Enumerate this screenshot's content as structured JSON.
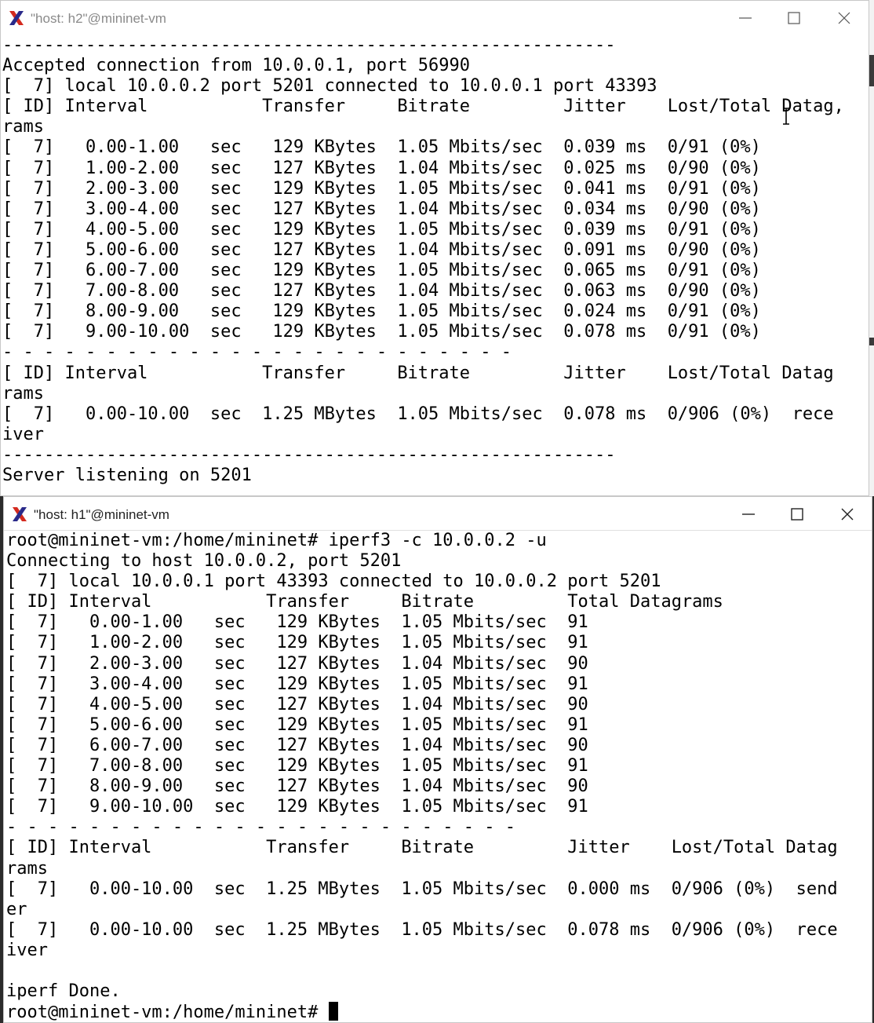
{
  "windows": [
    {
      "id": "h2",
      "title": "\"host: h2\"@mininet-vm",
      "lines": [
        "-----------------------------------------------------------",
        "Accepted connection from 10.0.0.1, port 56990",
        "[  7] local 10.0.0.2 port 5201 connected to 10.0.0.1 port 43393",
        "[ ID] Interval           Transfer     Bitrate         Jitter    Lost/Total Datag,",
        "rams",
        "[  7]   0.00-1.00   sec   129 KBytes  1.05 Mbits/sec  0.039 ms  0/91 (0%)",
        "[  7]   1.00-2.00   sec   127 KBytes  1.04 Mbits/sec  0.025 ms  0/90 (0%)",
        "[  7]   2.00-3.00   sec   129 KBytes  1.05 Mbits/sec  0.041 ms  0/91 (0%)",
        "[  7]   3.00-4.00   sec   127 KBytes  1.04 Mbits/sec  0.034 ms  0/90 (0%)",
        "[  7]   4.00-5.00   sec   129 KBytes  1.05 Mbits/sec  0.039 ms  0/91 (0%)",
        "[  7]   5.00-6.00   sec   127 KBytes  1.04 Mbits/sec  0.091 ms  0/90 (0%)",
        "[  7]   6.00-7.00   sec   129 KBytes  1.05 Mbits/sec  0.065 ms  0/91 (0%)",
        "[  7]   7.00-8.00   sec   127 KBytes  1.04 Mbits/sec  0.063 ms  0/90 (0%)",
        "[  7]   8.00-9.00   sec   129 KBytes  1.05 Mbits/sec  0.024 ms  0/91 (0%)",
        "[  7]   9.00-10.00  sec   129 KBytes  1.05 Mbits/sec  0.078 ms  0/91 (0%)",
        "- - - - - - - - - - - - - - - - - - - - - - - - -",
        "[ ID] Interval           Transfer     Bitrate         Jitter    Lost/Total Datag",
        "rams",
        "[  7]   0.00-10.00  sec  1.25 MBytes  1.05 Mbits/sec  0.078 ms  0/906 (0%)  rece",
        "iver",
        "-----------------------------------------------------------",
        "Server listening on 5201"
      ]
    },
    {
      "id": "h1",
      "title": "\"host: h1\"@mininet-vm",
      "lines": [
        "root@mininet-vm:/home/mininet# iperf3 -c 10.0.0.2 -u",
        "Connecting to host 10.0.0.2, port 5201",
        "[  7] local 10.0.0.1 port 43393 connected to 10.0.0.2 port 5201",
        "[ ID] Interval           Transfer     Bitrate         Total Datagrams",
        "[  7]   0.00-1.00   sec   129 KBytes  1.05 Mbits/sec  91",
        "[  7]   1.00-2.00   sec   129 KBytes  1.05 Mbits/sec  91",
        "[  7]   2.00-3.00   sec   127 KBytes  1.04 Mbits/sec  90",
        "[  7]   3.00-4.00   sec   129 KBytes  1.05 Mbits/sec  91",
        "[  7]   4.00-5.00   sec   127 KBytes  1.04 Mbits/sec  90",
        "[  7]   5.00-6.00   sec   129 KBytes  1.05 Mbits/sec  91",
        "[  7]   6.00-7.00   sec   127 KBytes  1.04 Mbits/sec  90",
        "[  7]   7.00-8.00   sec   129 KBytes  1.05 Mbits/sec  91",
        "[  7]   8.00-9.00   sec   127 KBytes  1.04 Mbits/sec  90",
        "[  7]   9.00-10.00  sec   129 KBytes  1.05 Mbits/sec  91",
        "- - - - - - - - - - - - - - - - - - - - - - - - -",
        "[ ID] Interval           Transfer     Bitrate         Jitter    Lost/Total Datag",
        "rams",
        "[  7]   0.00-10.00  sec  1.25 MBytes  1.05 Mbits/sec  0.000 ms  0/906 (0%)  send",
        "er",
        "[  7]   0.00-10.00  sec  1.25 MBytes  1.05 Mbits/sec  0.078 ms  0/906 (0%)  rece",
        "iver",
        "",
        "iperf Done.",
        "root@mininet-vm:/home/mininet# "
      ]
    }
  ],
  "icons": {
    "app": "xterm-x-icon",
    "minimize": "minimize-icon",
    "maximize": "maximize-icon",
    "close": "close-icon"
  },
  "colors": {
    "terminal_bg": "#ffffff",
    "terminal_fg": "#000000",
    "xterm_icon_red": "#d42a1e"
  }
}
